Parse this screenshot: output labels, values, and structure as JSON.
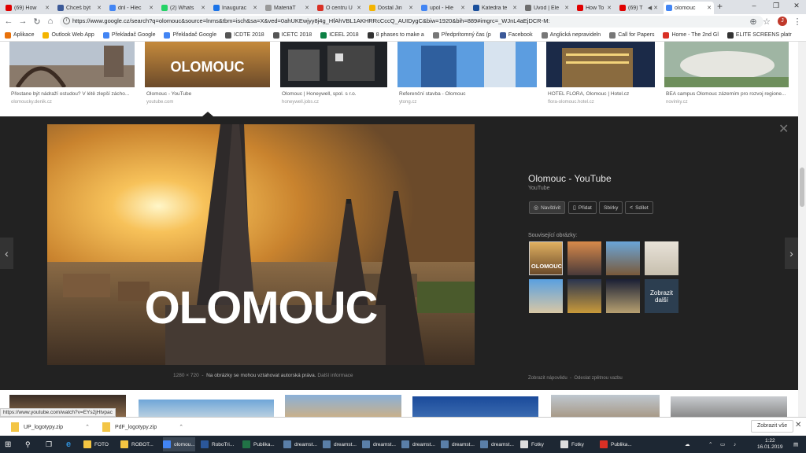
{
  "tabs": [
    {
      "label": "(69) How",
      "color": "#e00000"
    },
    {
      "label": "Chceš být",
      "color": "#3b5998"
    },
    {
      "label": "dril - Hlec",
      "color": "#4285f4"
    },
    {
      "label": "(2) Whats",
      "color": "#25d366"
    },
    {
      "label": "Inaugurac",
      "color": "#1a73e8"
    },
    {
      "label": "MateriáT",
      "color": "#999999"
    },
    {
      "label": "O centru U",
      "color": "#d93025"
    },
    {
      "label": "Dostal Jiri",
      "color": "#f4b400"
    },
    {
      "label": "upol - Hle",
      "color": "#4285f4"
    },
    {
      "label": "Katedra te",
      "color": "#1a4f9c"
    },
    {
      "label": "Úvod | Ele",
      "color": "#6d6d6d"
    },
    {
      "label": "How To M",
      "color": "#e00000"
    },
    {
      "label": "(69) T",
      "color": "#e00000"
    },
    {
      "label": "olomouc",
      "color": "#4285f4"
    }
  ],
  "address": {
    "url": "https://www.google.cz/search?q=olomouc&source=lnms&tbm=isch&sa=X&ved=0ahUKEwjyy8j4g_HfAhVBL1AKHRRcCccQ_AUIDygC&biw=1920&bih=889#imgrc=_WJnL4aEjDCR-M:"
  },
  "bookmarks": [
    {
      "label": "Aplikace",
      "color": "#e8710a"
    },
    {
      "label": "Outlook Web App",
      "color": "#f4b400"
    },
    {
      "label": "Překladač Google",
      "color": "#4285f4"
    },
    {
      "label": "Překladač Google",
      "color": "#4285f4"
    },
    {
      "label": "ICDTE 2018",
      "color": "#555555"
    },
    {
      "label": "ICETC 2018",
      "color": "#555555"
    },
    {
      "label": "ICEEL 2018",
      "color": "#0b8043"
    },
    {
      "label": "8 phases to make a",
      "color": "#333333"
    },
    {
      "label": "Předprítomný čas (p",
      "color": "#777777"
    },
    {
      "label": "Facebook",
      "color": "#3b5998"
    },
    {
      "label": "Anglická nepravideln",
      "color": "#777777"
    },
    {
      "label": "Call for Papers",
      "color": "#777777"
    },
    {
      "label": "Home - The 2nd Gl",
      "color": "#d93025"
    },
    {
      "label": "ELITE SCREENS platr",
      "color": "#333333"
    }
  ],
  "top_results": [
    {
      "caption": "Přestane být nádraží ostudou? V létě zlepší zácho...",
      "source": "olomoucky.denik.cz"
    },
    {
      "caption": "Olomouc - YouTube",
      "source": "youtube.com",
      "overlay": "OLOMOUC"
    },
    {
      "caption": "Olomouc | Honeywell, spol. s r.o.",
      "source": "honeywell.jobs.cz"
    },
    {
      "caption": "Referenční stavba - Olomouc",
      "source": "ytong.cz"
    },
    {
      "caption": "HOTEL FLORA, Olomouc | Hotel.cz",
      "source": "flora-olomouc.hotel.cz"
    },
    {
      "caption": "BEA campus Olomouc zázemím pro rozvoj regione...",
      "source": "novinky.cz"
    }
  ],
  "viewer": {
    "overlay_text": "OLOMOUC",
    "dimensions": "1280 × 720",
    "copyright": "Na obrázky se mohou vztahovat autorská práva.",
    "more_info": "Další informace",
    "title": "Olomouc - YouTube",
    "subtitle": "YouTube",
    "actions": {
      "visit": "Navštívit",
      "add": "Přidat",
      "collections": "Sbírky",
      "share": "Sdílet"
    },
    "related_label": "Související obrázky:",
    "related_overlay": "OLOMOUC",
    "show_more": "Zobrazit další",
    "footer_hints": "Zobrazit nápovědu",
    "footer_feedback": "Odeslat zpětnou vazbu"
  },
  "status_url": "https://www.youtube.com/watch?v=EYs2jHtvpac",
  "downloads": [
    {
      "name": "UP_logotypy.zip"
    },
    {
      "name": "PdF_logotypy.zip"
    }
  ],
  "shelf": {
    "show_all": "Zobrazit vše"
  },
  "taskbar": [
    {
      "label": "FOTO",
      "color": "#f4c542"
    },
    {
      "label": "ROBOT...",
      "color": "#f4c542"
    },
    {
      "label": "olomou...",
      "color": "#4285f4"
    },
    {
      "label": "RoboTri...",
      "color": "#2b579a"
    },
    {
      "label": "Publika...",
      "color": "#217346"
    },
    {
      "label": "dreamst...",
      "color": "#5a7fa8"
    },
    {
      "label": "dreamst...",
      "color": "#5a7fa8"
    },
    {
      "label": "dreamst...",
      "color": "#5a7fa8"
    },
    {
      "label": "dreamst...",
      "color": "#5a7fa8"
    },
    {
      "label": "dreamst...",
      "color": "#5a7fa8"
    },
    {
      "label": "dreamst...",
      "color": "#5a7fa8"
    },
    {
      "label": "Fotky",
      "color": "#dddddd"
    },
    {
      "label": "Fotky",
      "color": "#dddddd"
    },
    {
      "label": "Publika...",
      "color": "#d93025"
    }
  ],
  "clock": {
    "time": "1:22",
    "date": "16.01.2019"
  }
}
